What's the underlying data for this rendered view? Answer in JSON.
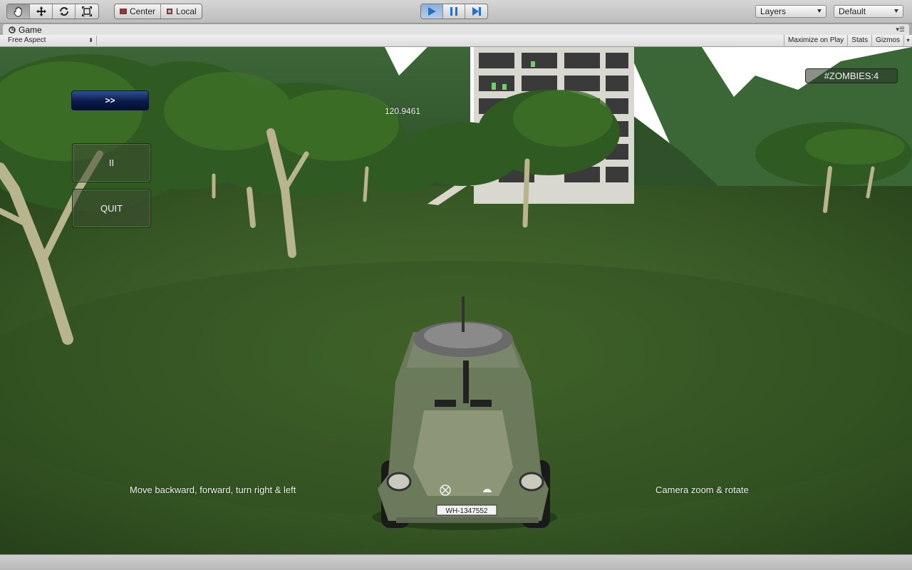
{
  "toolbar": {
    "transform_tools": [
      "hand-icon",
      "move-icon",
      "rotate-icon",
      "scale-icon"
    ],
    "pivot_center_label": "Center",
    "pivot_local_label": "Local",
    "play_controls": [
      "play-icon",
      "pause-icon",
      "step-icon"
    ],
    "layers_label": "Layers",
    "layout_label": "Default"
  },
  "panel": {
    "tab_label": "Game",
    "aspect_label": "Free Aspect",
    "maximize_label": "Maximize on Play",
    "stats_label": "Stats",
    "gizmos_label": "Gizmos"
  },
  "hud": {
    "next_label": ">>",
    "pause_label": "II",
    "quit_label": "QUIT",
    "timer": "120.9461",
    "zombies": "#ZOMBIES:4",
    "move_hint": "Move backward, forward, turn right & left",
    "camera_hint": "Camera zoom & rotate"
  },
  "scene": {
    "license_plate": "WH-1347552"
  },
  "colors": {
    "play_active": "#8eb0d6",
    "grass": "#3f6427",
    "sky": "#ffffff"
  }
}
